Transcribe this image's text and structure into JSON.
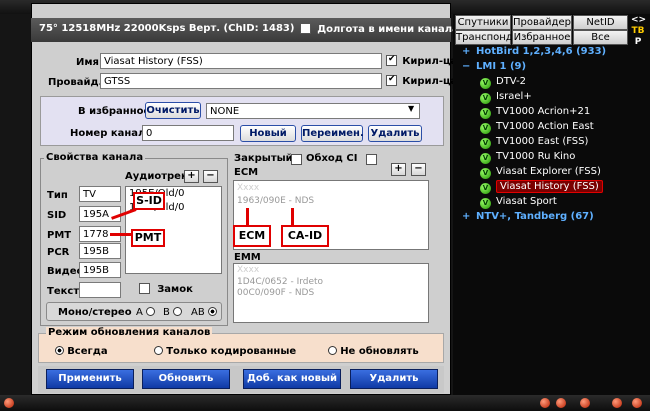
{
  "dialog": {
    "title": "75° 12518MHz 22000Ksps Верт. (ChID: 1483)",
    "long_names_label": "Долгота в имени канала",
    "name_label": "Имя",
    "name_value": "Viasat History (FSS)",
    "cyrillic_label_1": "Кирил-ца",
    "provider_label": "Провайд.",
    "provider_value": "GTSS",
    "cyrillic_label_2": "Кирил-ца",
    "favorites_label": "В избранное:",
    "clear_label": "Очистить",
    "favorites_value": "NONE",
    "channel_number_label": "Номер канала",
    "channel_number_value": "0",
    "new_label": "Новый",
    "rename_label": "Переимен.",
    "delete_small_label": "Удалить"
  },
  "channel_props": {
    "title": "Свойства канала",
    "audio_label": "Аудиотрек",
    "audio_items": [
      "195E/Old/0",
      "195E/Old/0"
    ],
    "type_label": "Тип",
    "type_value": "TV",
    "sid_label": "SID",
    "sid_value": "195A",
    "pmt_label": "PMT",
    "pmt_value": "1778",
    "pcr_label": "PCR",
    "pcr_value": "195B",
    "video_label": "Видео",
    "video_value": "195B",
    "text_label": "Текст",
    "text_value": "",
    "lock_label": "Замок",
    "mono_label": "Моно/стерео",
    "opt_a": "A",
    "opt_b": "B",
    "opt_ab": "AB"
  },
  "annotations": {
    "sid": "S-ID",
    "pmt": "PMT",
    "ecm": "ECM",
    "caid": "CA-ID"
  },
  "encryption": {
    "closed_label": "Закрытый",
    "bypass_label": "Обход CI",
    "ecm_label": "ECM",
    "ecm_items": [
      "Xxxx",
      "1963/090E - NDS"
    ],
    "emm_label": "EMM",
    "emm_items": [
      "Xxxx",
      "1D4C/0652 - Irdeto",
      "00C0/090F - NDS"
    ]
  },
  "update_mode": {
    "title": "Режим обновления каналов",
    "always": "Всегда",
    "only_coded": "Только кодированные",
    "no_update": "Не обновлять"
  },
  "actions": {
    "apply": "Применить",
    "update": "Обновить",
    "add_new": "Доб. как новый",
    "delete": "Удалить"
  },
  "right_panel": {
    "tabs_row1": [
      "Спутники",
      "Провайдер",
      "NetID"
    ],
    "tabs_row2": [
      "Транспонд.",
      "Избранное",
      "Все"
    ],
    "side_markers": [
      "<>",
      "ТВ",
      "Р"
    ],
    "tree": [
      {
        "toggle": "+",
        "label": "HotBird 1,2,3,4,6 (933)",
        "head": true
      },
      {
        "toggle": "−",
        "label": "LMI 1 (9)",
        "head": true
      },
      {
        "label": "DTV-2"
      },
      {
        "label": "Israel+"
      },
      {
        "label": "TV1000 Acrion+21"
      },
      {
        "label": "TV1000 Action East"
      },
      {
        "label": "TV1000 East (FSS)"
      },
      {
        "label": "TV1000 Ru Kino"
      },
      {
        "label": "Viasat Explorer (FSS)"
      },
      {
        "label": "Viasat History (FSS)",
        "selected": true
      },
      {
        "label": "Viasat Sport"
      },
      {
        "toggle": "+",
        "label": "NTV+, Tandberg (67)",
        "head": true
      }
    ],
    "icon_letter": "V"
  },
  "colors": {
    "annotation_red": "#e00000",
    "primary_blue": "#0f3aa5",
    "tree_head": "#5fb0ff",
    "selected_border": "#e00000"
  }
}
